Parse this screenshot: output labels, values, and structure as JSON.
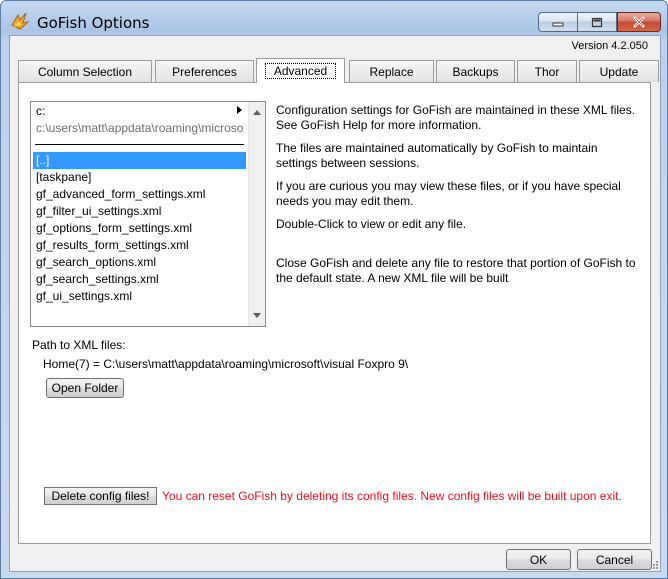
{
  "window": {
    "title": "GoFish Options",
    "version": "Version 4.2.050"
  },
  "tabs": [
    {
      "label": "Column Selection"
    },
    {
      "label": "Preferences"
    },
    {
      "label": "Advanced",
      "active": true
    },
    {
      "label": "Replace"
    },
    {
      "label": "Backups"
    },
    {
      "label": "Thor"
    },
    {
      "label": "Update"
    }
  ],
  "file_browser": {
    "drive": "c:",
    "current_path": "c:\\users\\matt\\appdata\\roaming\\microso",
    "items": [
      {
        "name": "[..]",
        "selected": true
      },
      {
        "name": "[taskpane]"
      },
      {
        "name": "gf_advanced_form_settings.xml"
      },
      {
        "name": "gf_filter_ui_settings.xml"
      },
      {
        "name": "gf_options_form_settings.xml"
      },
      {
        "name": "gf_results_form_settings.xml"
      },
      {
        "name": "gf_search_options.xml"
      },
      {
        "name": "gf_search_settings.xml"
      },
      {
        "name": "gf_ui_settings.xml"
      }
    ]
  },
  "description": {
    "p1": "Configuration settings for GoFish are maintained in these XML files. See GoFish Help for more information.",
    "p2": "The files are maintained automatically by GoFish to maintain settings between sessions.",
    "p3": "If you are curious you may view these files, or if you have special needs you may edit them.",
    "p4": "Double-Click to view or edit any file.",
    "p5": "Close GoFish and delete any file to restore that portion of GoFish to the default state. A new XML file will be built"
  },
  "xml_path": {
    "label": "Path to XML files:",
    "value": "Home(7)  =  C:\\users\\matt\\appdata\\roaming\\microsoft\\visual Foxpro 9\\",
    "open_folder_label": "Open Folder"
  },
  "reset": {
    "button_label": "Delete config files!",
    "message": "You can reset GoFish by deleting its config files. New config files will be built upon exit.",
    "message_color": "#e81123"
  },
  "footer": {
    "ok_label": "OK",
    "cancel_label": "Cancel"
  },
  "colors": {
    "selection": "#3399ff",
    "close_button": "#c24a30"
  }
}
